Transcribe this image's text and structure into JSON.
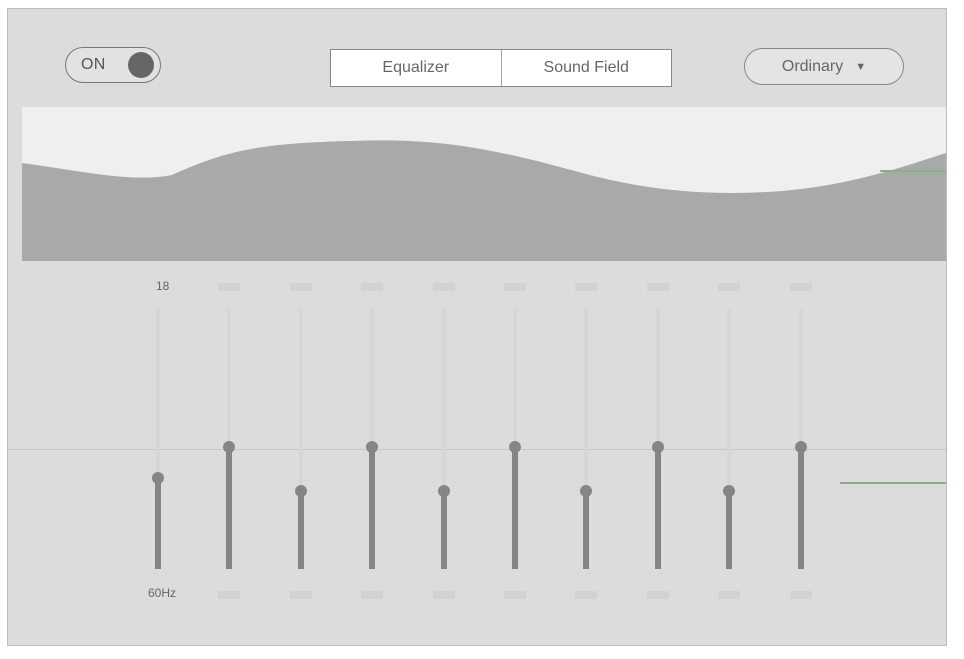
{
  "power": {
    "label": "ON",
    "on": true
  },
  "tabs": [
    {
      "label": "Equalizer",
      "selected": true
    },
    {
      "label": "Sound Field",
      "selected": false
    }
  ],
  "preset": {
    "selected": "Ordinary",
    "arrow": "▼"
  },
  "equalizer": {
    "top_label": "18",
    "bottom_label": "60Hz",
    "bands": [
      {
        "level": 0.35
      },
      {
        "level": 0.47
      },
      {
        "level": 0.3
      },
      {
        "level": 0.47
      },
      {
        "level": 0.3
      },
      {
        "level": 0.47
      },
      {
        "level": 0.3
      },
      {
        "level": 0.47
      },
      {
        "level": 0.3
      },
      {
        "level": 0.47
      }
    ]
  },
  "colors": {
    "accent_line": "#86b086",
    "slider_fill": "#858585",
    "curve": "#a8a9ab"
  }
}
